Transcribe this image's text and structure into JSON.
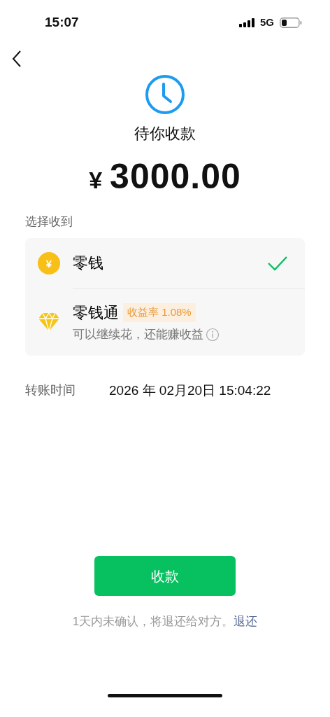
{
  "status_bar": {
    "time": "15:07",
    "network": "5G"
  },
  "status": {
    "title": "待你收款",
    "currency": "¥",
    "amount": "3000.00"
  },
  "receive_to": {
    "label": "选择收到",
    "options": [
      {
        "kind": "balance",
        "icon_text": "¥",
        "name": "零钱",
        "selected": true
      },
      {
        "kind": "fund",
        "name": "零钱通",
        "tag": "收益率 1.08%",
        "subtitle": "可以继续花，还能赚收益",
        "selected": false
      }
    ]
  },
  "transfer_time": {
    "label": "转账时间",
    "value": "2026 年 02月20日 15:04:22"
  },
  "action_button": "收款",
  "notice": {
    "text": "1天内未确认，将退还给对方。",
    "link": "退还"
  }
}
